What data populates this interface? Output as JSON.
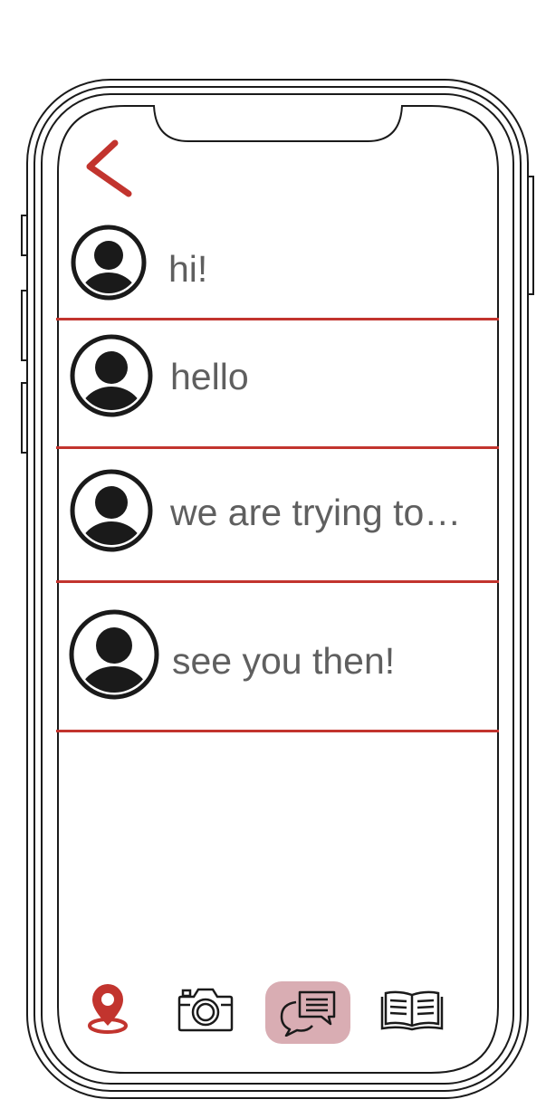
{
  "colors": {
    "accent": "#c2342e",
    "active_tab_background": "#d9adb3",
    "message_text": "#5f5f5f",
    "icon": "#1a1a1a"
  },
  "header": {
    "back_icon": "chevron-left-icon"
  },
  "chats": [
    {
      "message": "hi!",
      "avatar_icon": "user-avatar-icon"
    },
    {
      "message": "hello",
      "avatar_icon": "user-avatar-icon"
    },
    {
      "message": "we are trying to…",
      "avatar_icon": "user-avatar-icon"
    },
    {
      "message": "see you then!",
      "avatar_icon": "user-avatar-icon"
    }
  ],
  "tabbar": {
    "tabs": [
      {
        "icon": "map-pin-icon",
        "active": false
      },
      {
        "icon": "camera-icon",
        "active": false
      },
      {
        "icon": "chat-bubbles-icon",
        "active": true
      },
      {
        "icon": "open-book-icon",
        "active": false
      }
    ]
  }
}
